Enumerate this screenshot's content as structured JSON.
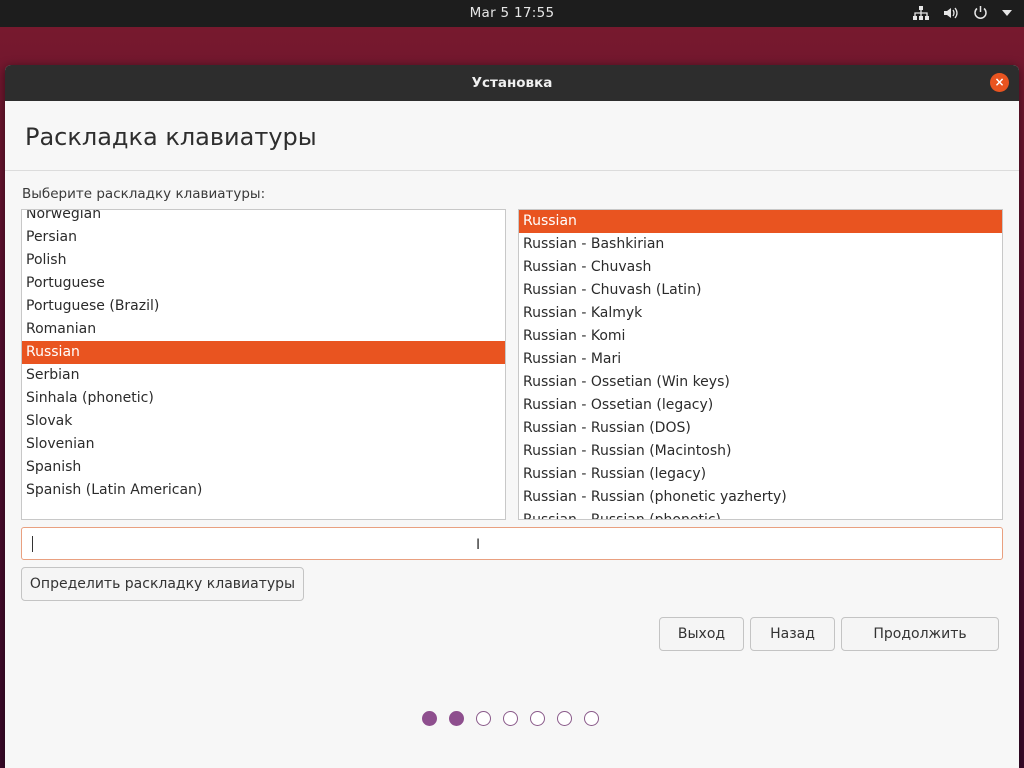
{
  "topbar": {
    "datetime": "Mar 5  17:55"
  },
  "window": {
    "title": "Установка",
    "close_label": "×",
    "heading": "Раскладка клавиатуры",
    "prompt": "Выберите раскладку клавиатуры:"
  },
  "layouts": [
    "Norwegian",
    "Persian",
    "Polish",
    "Portuguese",
    "Portuguese (Brazil)",
    "Romanian",
    "Russian",
    "Serbian",
    "Sinhala (phonetic)",
    "Slovak",
    "Slovenian",
    "Spanish",
    "Spanish (Latin American)"
  ],
  "selected_layout": "Russian",
  "variants": [
    "Russian",
    "Russian - Bashkirian",
    "Russian - Chuvash",
    "Russian - Chuvash (Latin)",
    "Russian - Kalmyk",
    "Russian - Komi",
    "Russian - Mari",
    "Russian - Ossetian (Win keys)",
    "Russian - Ossetian (legacy)",
    "Russian - Russian (DOS)",
    "Russian - Russian (Macintosh)",
    "Russian - Russian (legacy)",
    "Russian - Russian (phonetic yazherty)",
    "Russian - Russian (phonetic)"
  ],
  "selected_variant": "Russian",
  "test_input": {
    "value": "",
    "ibeam": "I"
  },
  "buttons": {
    "detect": "Определить раскладку клавиатуры",
    "quit": "Выход",
    "back": "Назад",
    "continue": "Продолжить"
  },
  "progress": {
    "total_steps": 7,
    "completed_steps": 2
  },
  "colors": {
    "accent": "#e95420",
    "progress": "#8e4f8e"
  }
}
